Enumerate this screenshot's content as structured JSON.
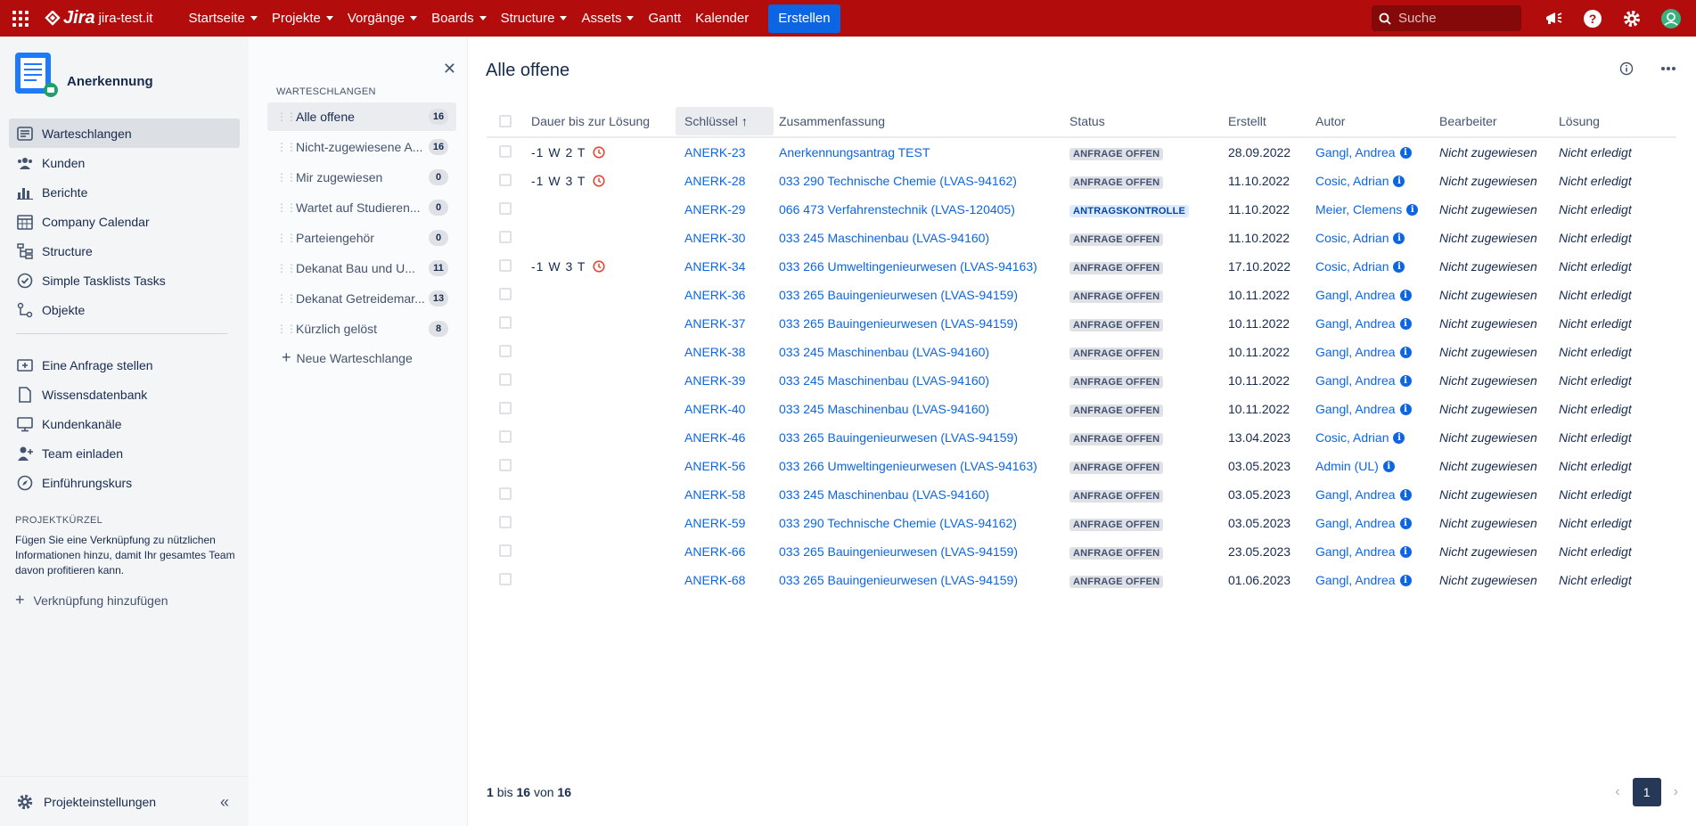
{
  "topnav": {
    "product": "Jira",
    "site": "jira-test.it",
    "items": [
      {
        "label": "Startseite",
        "dropdown": true
      },
      {
        "label": "Projekte",
        "dropdown": true
      },
      {
        "label": "Vorgänge",
        "dropdown": true
      },
      {
        "label": "Boards",
        "dropdown": true
      },
      {
        "label": "Structure",
        "dropdown": true
      },
      {
        "label": "Assets",
        "dropdown": true
      },
      {
        "label": "Gantt",
        "dropdown": false
      },
      {
        "label": "Kalender",
        "dropdown": false
      }
    ],
    "create_label": "Erstellen",
    "search_placeholder": "Suche"
  },
  "sidebar": {
    "project_name": "Anerkennung",
    "items": [
      {
        "label": "Warteschlangen",
        "icon": "queue-icon",
        "active": true
      },
      {
        "label": "Kunden",
        "icon": "people-icon"
      },
      {
        "label": "Berichte",
        "icon": "chart-icon"
      },
      {
        "label": "Company Calendar",
        "icon": "calendar-icon"
      },
      {
        "label": "Structure",
        "icon": "structure-icon"
      },
      {
        "label": "Simple Tasklists Tasks",
        "icon": "check-circle-icon"
      },
      {
        "label": "Objekte",
        "icon": "objects-icon"
      }
    ],
    "items2": [
      {
        "label": "Eine Anfrage stellen",
        "icon": "add-request-icon"
      },
      {
        "label": "Wissensdatenbank",
        "icon": "page-icon"
      },
      {
        "label": "Kundenkanäle",
        "icon": "monitor-icon"
      },
      {
        "label": "Team einladen",
        "icon": "add-person-icon"
      },
      {
        "label": "Einführungskurs",
        "icon": "compass-icon"
      }
    ],
    "shortcuts_heading": "PROJEKTKÜRZEL",
    "shortcuts_help": "Fügen Sie eine Verknüpfung zu nützlichen Informationen hinzu, damit Ihr gesamtes Team davon profitieren kann.",
    "add_link_label": "Verknüpfung hinzufügen",
    "settings_label": "Projekteinstellungen"
  },
  "queues": {
    "heading": "WARTESCHLANGEN",
    "items": [
      {
        "label": "Alle offene",
        "count": "16",
        "active": true
      },
      {
        "label": "Nicht-zugewiesene A...",
        "count": "16"
      },
      {
        "label": "Mir zugewiesen",
        "count": "0"
      },
      {
        "label": "Wartet auf Studieren...",
        "count": "0"
      },
      {
        "label": "Parteiengehör",
        "count": "0"
      },
      {
        "label": "Dekanat Bau und U...",
        "count": "11"
      },
      {
        "label": "Dekanat Getreidemar...",
        "count": "13"
      },
      {
        "label": "Kürzlich gelöst",
        "count": "8"
      }
    ],
    "new_queue_label": "Neue Warteschlange"
  },
  "main": {
    "title": "Alle offene",
    "columns": {
      "duration": "Dauer bis zur Lösung",
      "key": "Schlüssel",
      "summary": "Zusammenfassung",
      "status": "Status",
      "created": "Erstellt",
      "author": "Autor",
      "assignee": "Bearbeiter",
      "resolution": "Lösung"
    },
    "rows": [
      {
        "duration": "-1 W 2 T",
        "key": "ANERK-23",
        "summary": "Anerkennungsantrag TEST",
        "status": "ANFRAGE OFFEN",
        "status_color": "gray",
        "created": "28.09.2022",
        "author": "Gangl, Andrea",
        "assignee": "Nicht zugewiesen",
        "resolution": "Nicht erledigt"
      },
      {
        "duration": "-1 W 3 T",
        "key": "ANERK-28",
        "summary": "033 290 Technische Chemie (LVAS-94162)",
        "status": "ANFRAGE OFFEN",
        "status_color": "gray",
        "created": "11.10.2022",
        "author": "Cosic, Adrian",
        "assignee": "Nicht zugewiesen",
        "resolution": "Nicht erledigt"
      },
      {
        "duration": "",
        "key": "ANERK-29",
        "summary": "066 473 Verfahrenstechnik (LVAS-120405)",
        "status": "ANTRAGSKONTROLLE",
        "status_color": "blue",
        "created": "11.10.2022",
        "author": "Meier, Clemens",
        "assignee": "Nicht zugewiesen",
        "resolution": "Nicht erledigt"
      },
      {
        "duration": "",
        "key": "ANERK-30",
        "summary": "033 245 Maschinenbau (LVAS-94160)",
        "status": "ANFRAGE OFFEN",
        "status_color": "gray",
        "created": "11.10.2022",
        "author": "Cosic, Adrian",
        "assignee": "Nicht zugewiesen",
        "resolution": "Nicht erledigt"
      },
      {
        "duration": "-1 W 3 T",
        "key": "ANERK-34",
        "summary": "033 266 Umweltingenieurwesen (LVAS-94163)",
        "status": "ANFRAGE OFFEN",
        "status_color": "gray",
        "created": "17.10.2022",
        "author": "Cosic, Adrian",
        "assignee": "Nicht zugewiesen",
        "resolution": "Nicht erledigt"
      },
      {
        "duration": "",
        "key": "ANERK-36",
        "summary": "033 265 Bauingenieurwesen (LVAS-94159)",
        "status": "ANFRAGE OFFEN",
        "status_color": "gray",
        "created": "10.11.2022",
        "author": "Gangl, Andrea",
        "assignee": "Nicht zugewiesen",
        "resolution": "Nicht erledigt"
      },
      {
        "duration": "",
        "key": "ANERK-37",
        "summary": "033 265 Bauingenieurwesen (LVAS-94159)",
        "status": "ANFRAGE OFFEN",
        "status_color": "gray",
        "created": "10.11.2022",
        "author": "Gangl, Andrea",
        "assignee": "Nicht zugewiesen",
        "resolution": "Nicht erledigt"
      },
      {
        "duration": "",
        "key": "ANERK-38",
        "summary": "033 245 Maschinenbau (LVAS-94160)",
        "status": "ANFRAGE OFFEN",
        "status_color": "gray",
        "created": "10.11.2022",
        "author": "Gangl, Andrea",
        "assignee": "Nicht zugewiesen",
        "resolution": "Nicht erledigt"
      },
      {
        "duration": "",
        "key": "ANERK-39",
        "summary": "033 245 Maschinenbau (LVAS-94160)",
        "status": "ANFRAGE OFFEN",
        "status_color": "gray",
        "created": "10.11.2022",
        "author": "Gangl, Andrea",
        "assignee": "Nicht zugewiesen",
        "resolution": "Nicht erledigt"
      },
      {
        "duration": "",
        "key": "ANERK-40",
        "summary": "033 245 Maschinenbau (LVAS-94160)",
        "status": "ANFRAGE OFFEN",
        "status_color": "gray",
        "created": "10.11.2022",
        "author": "Gangl, Andrea",
        "assignee": "Nicht zugewiesen",
        "resolution": "Nicht erledigt"
      },
      {
        "duration": "",
        "key": "ANERK-46",
        "summary": "033 265 Bauingenieurwesen (LVAS-94159)",
        "status": "ANFRAGE OFFEN",
        "status_color": "gray",
        "created": "13.04.2023",
        "author": "Cosic, Adrian",
        "assignee": "Nicht zugewiesen",
        "resolution": "Nicht erledigt"
      },
      {
        "duration": "",
        "key": "ANERK-56",
        "summary": "033 266 Umweltingenieurwesen (LVAS-94163)",
        "status": "ANFRAGE OFFEN",
        "status_color": "gray",
        "created": "03.05.2023",
        "author": "Admin (UL)",
        "assignee": "Nicht zugewiesen",
        "resolution": "Nicht erledigt"
      },
      {
        "duration": "",
        "key": "ANERK-58",
        "summary": "033 245 Maschinenbau (LVAS-94160)",
        "status": "ANFRAGE OFFEN",
        "status_color": "gray",
        "created": "03.05.2023",
        "author": "Gangl, Andrea",
        "assignee": "Nicht zugewiesen",
        "resolution": "Nicht erledigt"
      },
      {
        "duration": "",
        "key": "ANERK-59",
        "summary": "033 290 Technische Chemie (LVAS-94162)",
        "status": "ANFRAGE OFFEN",
        "status_color": "gray",
        "created": "03.05.2023",
        "author": "Gangl, Andrea",
        "assignee": "Nicht zugewiesen",
        "resolution": "Nicht erledigt"
      },
      {
        "duration": "",
        "key": "ANERK-66",
        "summary": "033 265 Bauingenieurwesen (LVAS-94159)",
        "status": "ANFRAGE OFFEN",
        "status_color": "gray",
        "created": "23.05.2023",
        "author": "Gangl, Andrea",
        "assignee": "Nicht zugewiesen",
        "resolution": "Nicht erledigt"
      },
      {
        "duration": "",
        "key": "ANERK-68",
        "summary": "033 265 Bauingenieurwesen (LVAS-94159)",
        "status": "ANFRAGE OFFEN",
        "status_color": "gray",
        "created": "01.06.2023",
        "author": "Gangl, Andrea",
        "assignee": "Nicht zugewiesen",
        "resolution": "Nicht erledigt"
      }
    ],
    "footer": {
      "from": "1",
      "bis": "bis",
      "to": "16",
      "von": "von",
      "total": "16"
    },
    "pagination": {
      "current": "1"
    }
  },
  "colors": {
    "topnav_bg": "#b30c0c",
    "primary": "#0c66e4",
    "overdue": "#e34935"
  }
}
